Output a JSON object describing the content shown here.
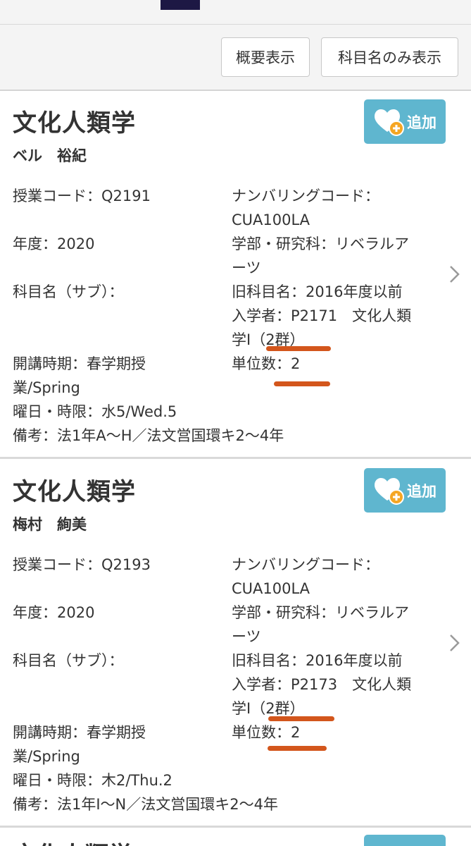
{
  "view_toggle": {
    "overview_label": "概要表示",
    "names_only_label": "科目名のみ表示"
  },
  "courses": [
    {
      "title": "文化人類学",
      "teacher": "ベル　裕紀",
      "add_label": "追加",
      "class_code": "授業コード：Q2191",
      "numbering_code_label": "ナンバリングコード：",
      "numbering_code": "CUA100LA",
      "year": "年度：2020",
      "faculty_line1": "学部・研究科：リベラルア",
      "faculty_line2": "ーツ",
      "subtitle": "科目名（サブ）：",
      "old_name_line1": "旧科目名：2016年度以前",
      "old_name_line2": "入学者：P2171　文化人類",
      "old_name_line3": "学Ⅰ（2群）",
      "term_line1": "開講時期：春学期授",
      "term_line2": "業/Spring",
      "credits": "単位数：2",
      "day_period": "曜日・時限：水5/Wed.5",
      "remarks": "備考：法1年A〜H／法文営国環キ2〜4年"
    },
    {
      "title": "文化人類学",
      "teacher": "梅村　絢美",
      "add_label": "追加",
      "class_code": "授業コード：Q2193",
      "numbering_code_label": "ナンバリングコード：",
      "numbering_code": "CUA100LA",
      "year": "年度：2020",
      "faculty_line1": "学部・研究科：リベラルア",
      "faculty_line2": "ーツ",
      "subtitle": "科目名（サブ）：",
      "old_name_line1": "旧科目名：2016年度以前",
      "old_name_line2": "入学者：P2173　文化人類",
      "old_name_line3": "学Ⅰ（2群）",
      "term_line1": "開講時期：春学期授",
      "term_line2": "業/Spring",
      "credits": "単位数：2",
      "day_period": "曜日・時限：木2/Thu.2",
      "remarks": "備考：法1年I〜N／法文営国環キ2〜4年"
    }
  ],
  "next_course_title": "文化人類学",
  "colors": {
    "add_button": "#5fb6cf",
    "annotation_marker": "#d3561c",
    "top_tab": "#1d1844"
  },
  "icons": {
    "add_favorite": "heart-plus-icon",
    "open_detail": "chevron-right-icon"
  }
}
